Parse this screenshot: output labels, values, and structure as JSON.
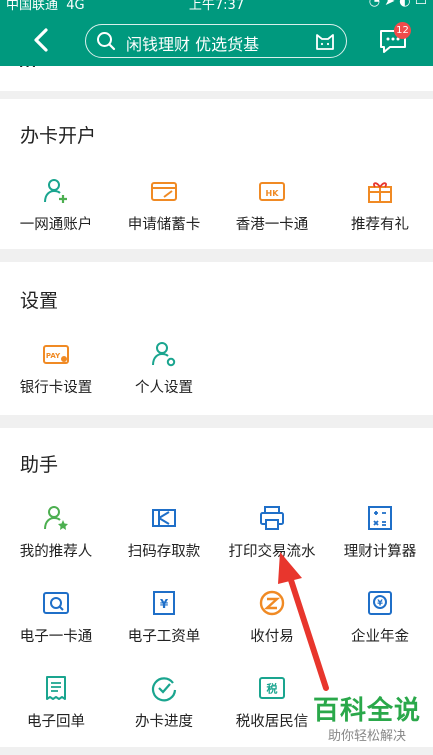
{
  "status_bar": {
    "carrier": "中国联通",
    "network": "4G",
    "time": "上午7:37"
  },
  "header": {
    "search_text": "闲钱理财 优选货基",
    "message_badge": "12"
  },
  "sections": [
    {
      "title": "办卡开户",
      "items": [
        {
          "label": "一网通账户",
          "icon": "user-add-icon"
        },
        {
          "label": "申请储蓄卡",
          "icon": "card-apply-icon"
        },
        {
          "label": "香港一卡通",
          "icon": "hk-card-icon"
        },
        {
          "label": "推荐有礼",
          "icon": "gift-icon"
        }
      ]
    },
    {
      "title": "设置",
      "items": [
        {
          "label": "银行卡设置",
          "icon": "card-settings-icon"
        },
        {
          "label": "个人设置",
          "icon": "user-settings-icon"
        }
      ]
    },
    {
      "title": "助手",
      "items": [
        {
          "label": "我的推荐人",
          "icon": "referrer-icon"
        },
        {
          "label": "扫码存取款",
          "icon": "scan-icon"
        },
        {
          "label": "打印交易流水",
          "icon": "printer-icon"
        },
        {
          "label": "理财计算器",
          "icon": "calculator-icon"
        },
        {
          "label": "电子一卡通",
          "icon": "e-card-icon"
        },
        {
          "label": "电子工资单",
          "icon": "payslip-icon"
        },
        {
          "label": "收付易",
          "icon": "payment-icon"
        },
        {
          "label": "企业年金",
          "icon": "annuity-icon"
        },
        {
          "label": "电子回单",
          "icon": "receipt-icon"
        },
        {
          "label": "办卡进度",
          "icon": "progress-icon"
        },
        {
          "label": "税收居民信",
          "icon": "tax-icon"
        }
      ]
    }
  ],
  "watermark": {
    "title": "百科全说",
    "subtitle": "助你轻松解决"
  },
  "colors": {
    "header": "#00997e",
    "teal": "#1aa58f",
    "orange": "#f08a24",
    "blue": "#1f6fc8",
    "green": "#4caf50",
    "red_arrow": "#e8362d"
  }
}
